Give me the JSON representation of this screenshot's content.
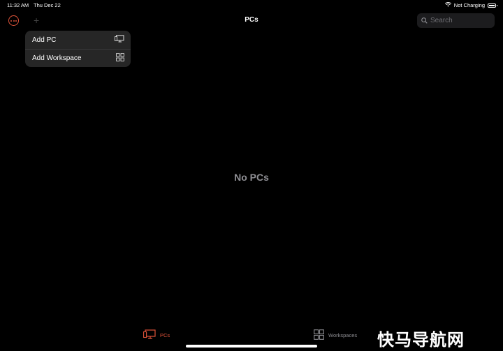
{
  "status_bar": {
    "time": "11:32 AM",
    "date": "Thu Dec 22",
    "charging": "Not Charging"
  },
  "nav": {
    "title": "PCs",
    "search_placeholder": "Search",
    "add_symbol": "+"
  },
  "menu": {
    "items": [
      {
        "label": "Add PC",
        "icon": "add-pc-icon"
      },
      {
        "label": "Add Workspace",
        "icon": "workspace-icon"
      }
    ]
  },
  "main": {
    "empty_text": "No PCs"
  },
  "tabs": [
    {
      "label": "PCs",
      "icon": "monitor-icon",
      "active": true
    },
    {
      "label": "Workspaces",
      "icon": "workspaces-icon",
      "active": false
    }
  ],
  "watermark": "快马导航网",
  "colors": {
    "accent": "#e0533a",
    "background": "#000000",
    "menu_bg": "#262626",
    "muted": "#8e8e93"
  }
}
